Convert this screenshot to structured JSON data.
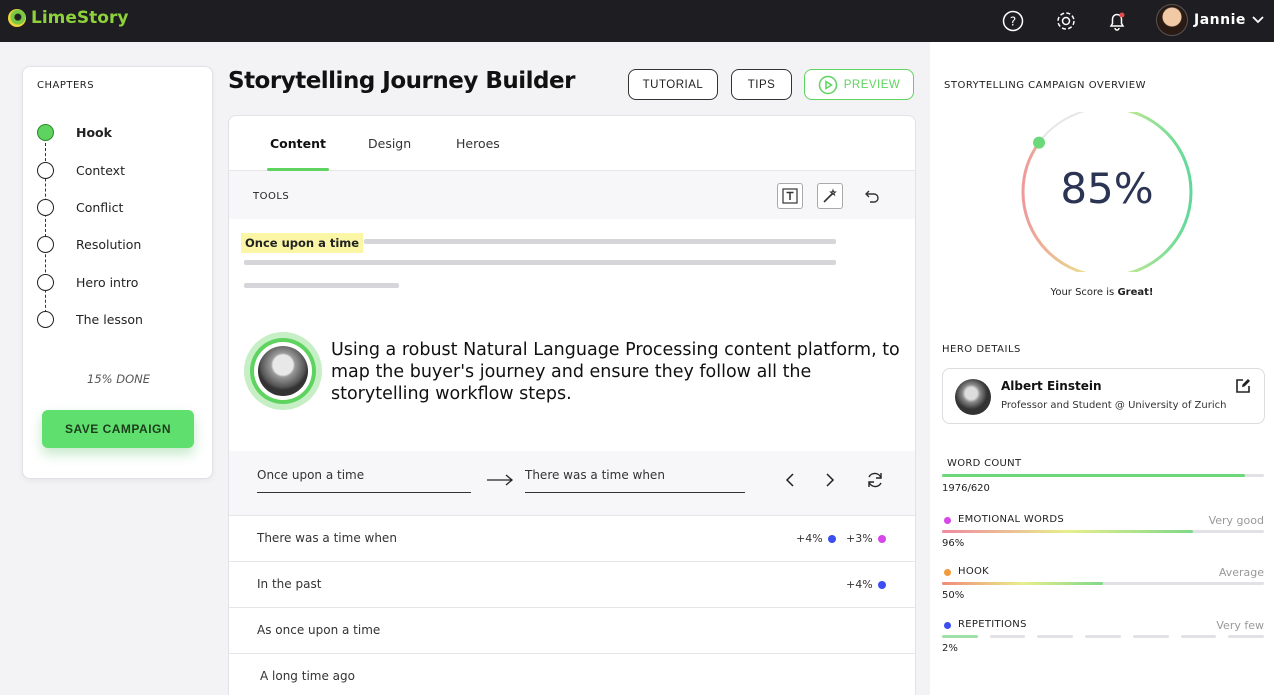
{
  "app": {
    "name": "LimeStory"
  },
  "topbar": {
    "user_name": "Jannie"
  },
  "chapters": {
    "title": "CHAPTERS",
    "items": [
      {
        "label": "Hook",
        "active": true
      },
      {
        "label": "Context",
        "active": false
      },
      {
        "label": "Conflict",
        "active": false
      },
      {
        "label": "Resolution",
        "active": false
      },
      {
        "label": "Hero intro",
        "active": false
      },
      {
        "label": "The lesson",
        "active": false
      }
    ],
    "progress_text": "15% DONE",
    "progress_value": 0.15,
    "save_label": "SAVE CAMPAIGN"
  },
  "header": {
    "title": "Storytelling Journey Builder",
    "tutorial_label": "TUTORIAL",
    "tips_label": "TIPS",
    "preview_label": "PREVIEW"
  },
  "editor": {
    "tabs": [
      "Content",
      "Design",
      "Heroes"
    ],
    "active_tab": "Content",
    "tools_label": "TOOLS",
    "highlight_text": "Once upon a time",
    "hero_text": "Using a robust Natural Language Processing content platform, to map the buyer's journey and ensure they follow all the storytelling workflow steps.",
    "suggestion": {
      "from": "Once upon a time",
      "to": "There was a time when"
    },
    "alternatives": [
      {
        "text": "There was a time when",
        "badges": [
          {
            "value": "+4%",
            "color": "#3b4ef2"
          },
          {
            "value": "+3%",
            "color": "#d646e8"
          }
        ]
      },
      {
        "text": "In the past",
        "badges": [
          {
            "value": "+4%",
            "color": "#3b4ef2"
          }
        ]
      },
      {
        "text": "As once upon a time",
        "badges": []
      },
      {
        "text": "A long time ago",
        "badges": []
      }
    ]
  },
  "overview": {
    "title": "STORYTELLING CAMPAIGN OVERVIEW",
    "score": "85%",
    "score_value": 0.85,
    "score_caption_prefix": "Your Score is ",
    "score_caption_strong": "Great!"
  },
  "hero": {
    "title": "HERO DETAILS",
    "name": "Albert Einstein",
    "subtitle": "Professor and Student @ University of Zurich"
  },
  "metrics": {
    "word_count": {
      "label": "WORD COUNT",
      "value": "1976/620",
      "fill": 0.94,
      "color": "#6cd87a"
    },
    "emotional": {
      "label": "EMOTIONAL WORDS",
      "rating": "Very good",
      "value": "96%",
      "fill": 0.78,
      "color": "#d646e8"
    },
    "hook": {
      "label": "HOOK",
      "rating": "Average",
      "value": "50%",
      "fill": 0.5,
      "color": "#f39a3a"
    },
    "repetitions": {
      "label": "REPETITIONS",
      "rating": "Very few",
      "value": "2%",
      "fill": 0.02,
      "color": "#3b4ef2"
    }
  },
  "colors": {
    "accent": "#5fd35f",
    "topbar": "#1e1e22",
    "score_text": "#2b3553"
  }
}
